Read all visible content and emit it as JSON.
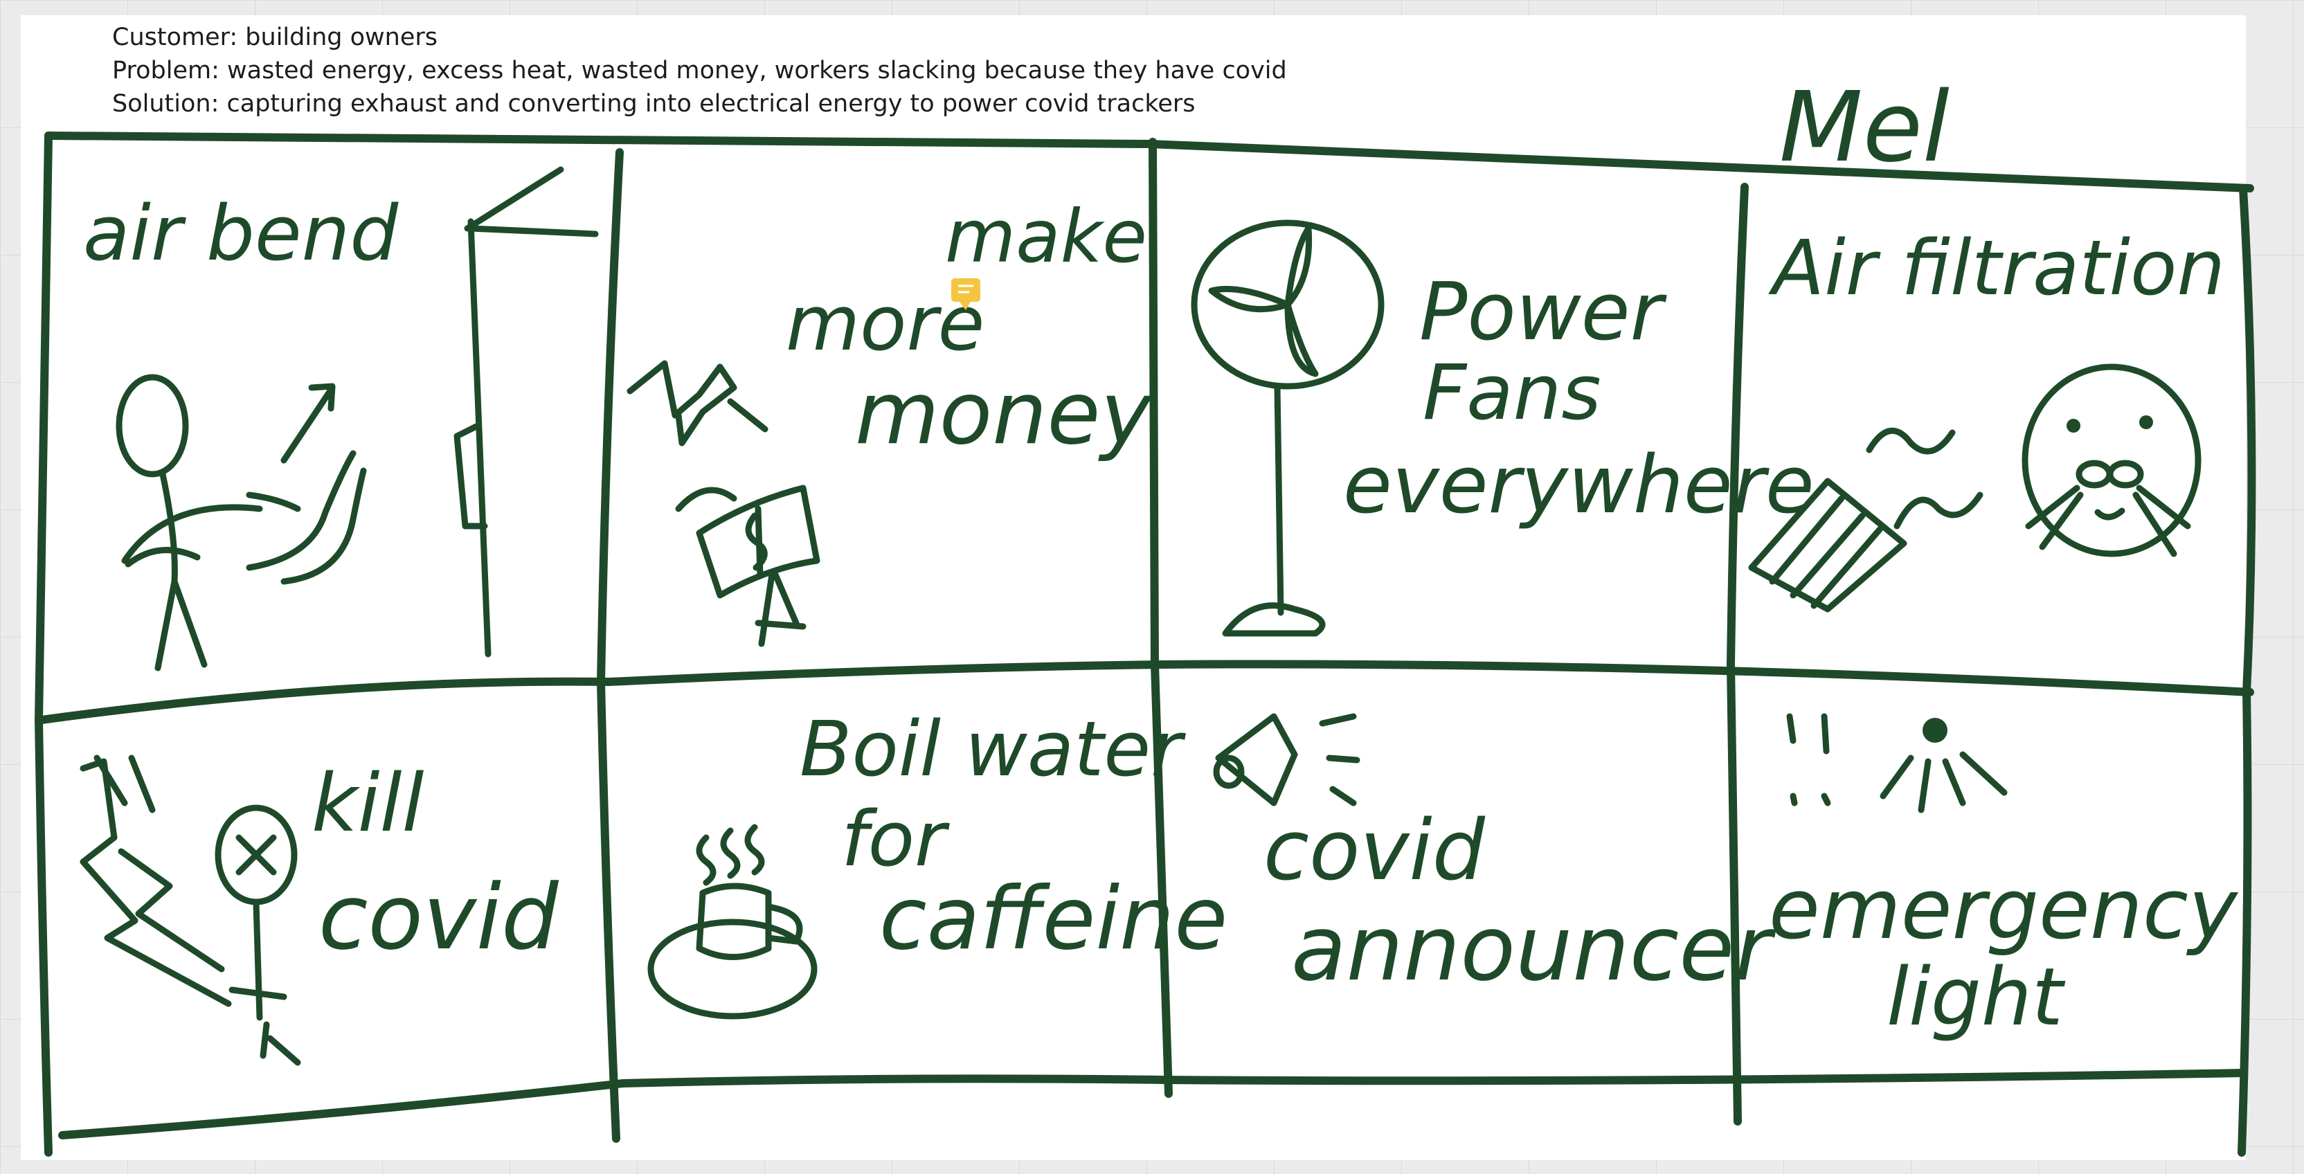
{
  "notes": {
    "customer": "Customer: building owners",
    "problem": "Problem: wasted energy, excess heat, wasted money, workers slacking because they have covid",
    "solution": "Solution: capturing exhaust and converting into electrical energy to power covid trackers"
  },
  "author": "Mel",
  "panels": [
    {
      "lines": [
        "air bend"
      ]
    },
    {
      "lines": [
        "make",
        "more",
        "money"
      ]
    },
    {
      "lines": [
        "Power",
        "Fans",
        "everywhere"
      ]
    },
    {
      "lines": [
        "Air filtration"
      ]
    },
    {
      "lines": [
        "kill",
        "covid"
      ]
    },
    {
      "lines": [
        "Boil water",
        "for",
        "caffeine"
      ]
    },
    {
      "lines": [
        "covid",
        "announcer"
      ]
    },
    {
      "lines": [
        "emergency",
        "light"
      ]
    }
  ],
  "colors": {
    "ink": "#1e4a2a",
    "comment": "#f5c542",
    "canvas": "#ebebeb",
    "page": "#ffffff"
  },
  "icons": {
    "comment": "comment-icon"
  }
}
